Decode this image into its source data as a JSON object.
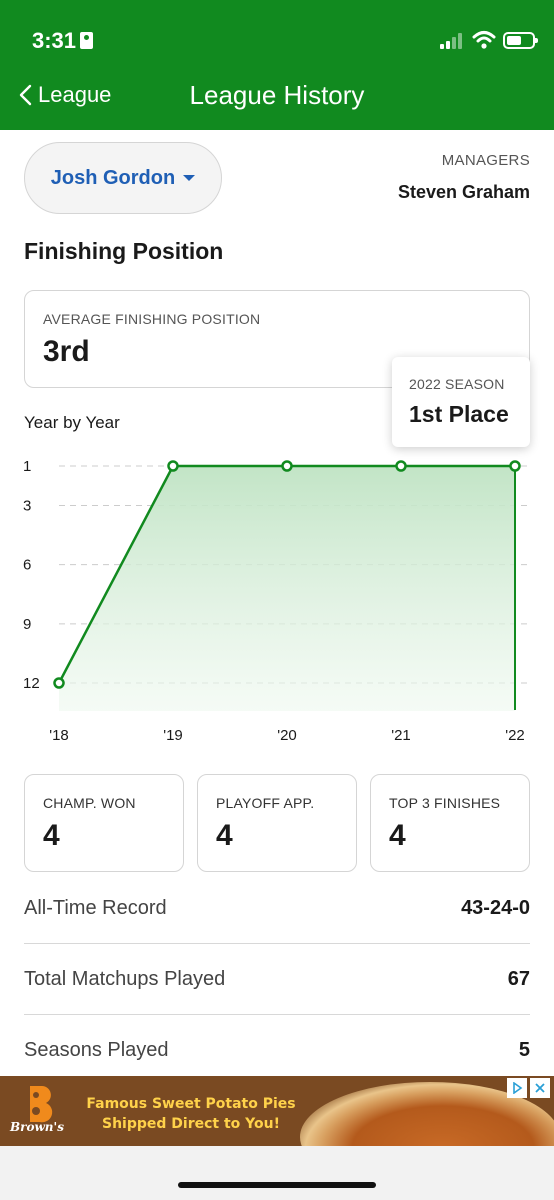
{
  "status_bar": {
    "time": "3:31"
  },
  "nav": {
    "back_label": "League",
    "title": "League History"
  },
  "manager_select": {
    "selected": "Josh Gordon"
  },
  "managers": {
    "label": "MANAGERS",
    "name": "Steven Graham"
  },
  "finishing": {
    "title": "Finishing Position",
    "avg_label": "AVERAGE FINISHING POSITION",
    "avg_value": "3rd",
    "year_by_year_label": "Year by Year"
  },
  "tooltip": {
    "label": "2022 SEASON",
    "value": "1st Place"
  },
  "chart_data": {
    "type": "area",
    "x": [
      "'18",
      "'19",
      "'20",
      "'21",
      "'22"
    ],
    "y_ticks": [
      "1",
      "3",
      "6",
      "9",
      "12"
    ],
    "series": [
      {
        "values": [
          12,
          1,
          1,
          1,
          1
        ]
      }
    ],
    "ylim": [
      1,
      12
    ],
    "y_inverted": true,
    "grid": true,
    "selected_index": 4,
    "colors": {
      "line": "#118a1f",
      "fill": "#cfe9d1"
    }
  },
  "stats": [
    {
      "label": "CHAMP. WON",
      "value": "4"
    },
    {
      "label": "PLAYOFF APP.",
      "value": "4"
    },
    {
      "label": "TOP 3 FINISHES",
      "value": "4"
    }
  ],
  "rows": [
    {
      "label": "All-Time Record",
      "value": "43-24-0"
    },
    {
      "label": "Total Matchups Played",
      "value": "67"
    },
    {
      "label": "Seasons Played",
      "value": "5"
    }
  ],
  "ad": {
    "line1": "Famous Sweet Potato Pies",
    "line2": "Shipped Direct to You!",
    "brand": "Brown's"
  },
  "theme": {
    "brand_green": "#118a1f",
    "link_blue": "#1f5fb5"
  }
}
